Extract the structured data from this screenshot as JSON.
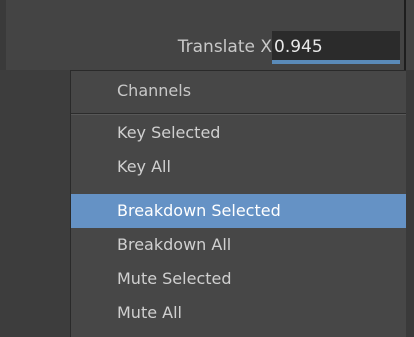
{
  "attribute": {
    "label": "Translate X",
    "value": "0.945"
  },
  "menu": {
    "header": "Channels",
    "items": [
      {
        "label": "Key Selected",
        "selected": false
      },
      {
        "label": "Key All",
        "selected": false
      },
      {
        "label": "Breakdown Selected",
        "selected": true
      },
      {
        "label": "Breakdown All",
        "selected": false
      },
      {
        "label": "Mute Selected",
        "selected": false
      },
      {
        "label": "Mute All",
        "selected": false
      }
    ]
  },
  "colors": {
    "highlight": "#6592c5",
    "field_underline": "#5a8ab8"
  }
}
